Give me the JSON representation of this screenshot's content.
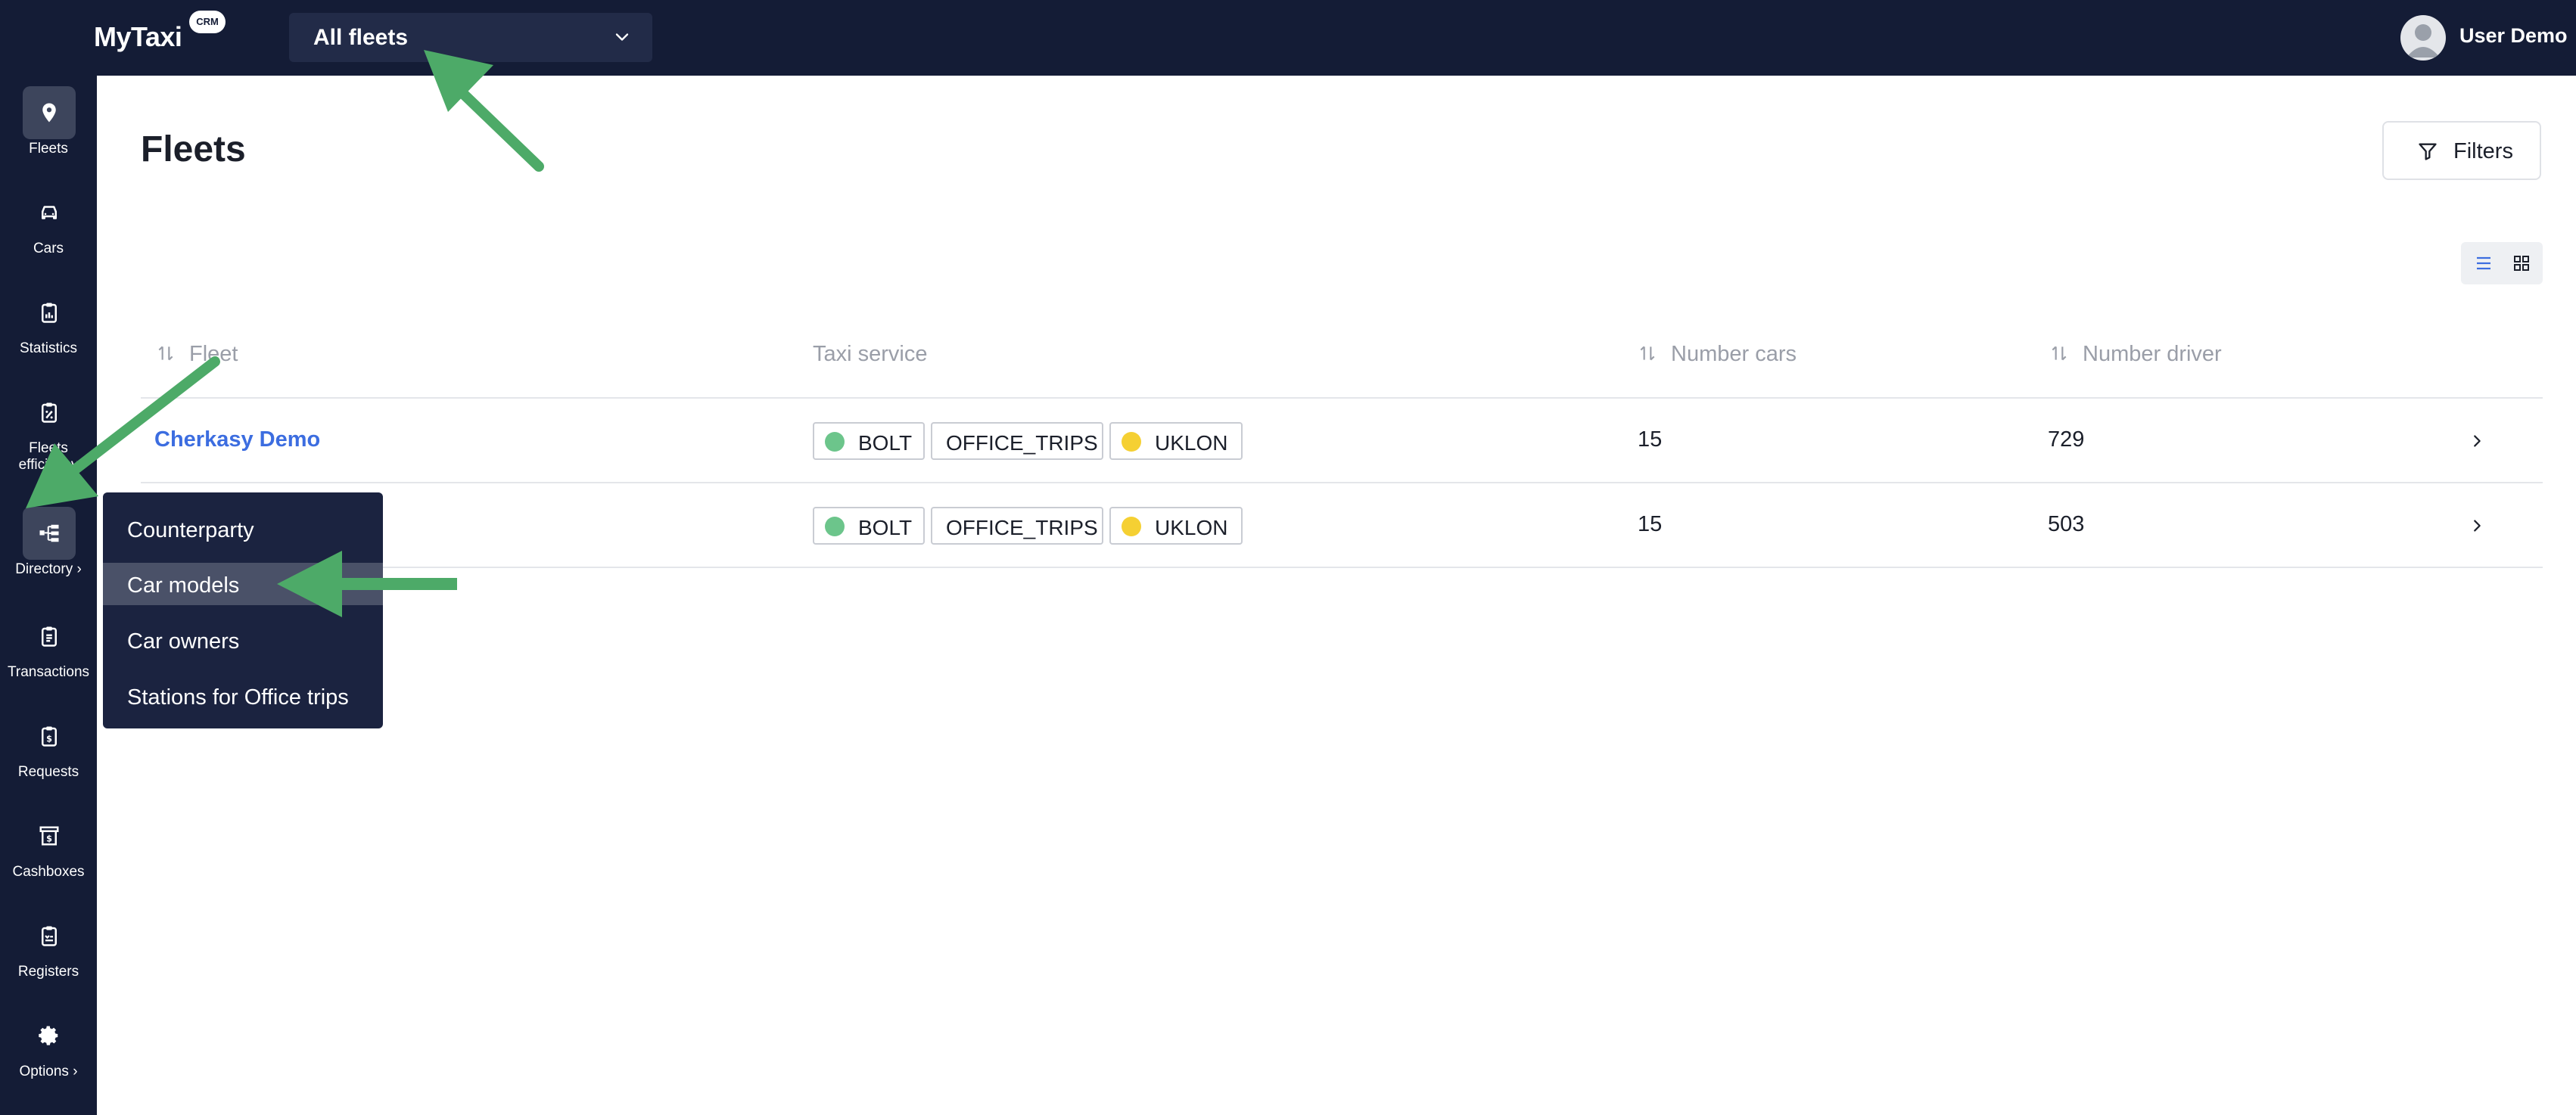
{
  "app": {
    "name": "MyTaxi",
    "badge": "CRM"
  },
  "header": {
    "fleet_selector": "All fleets",
    "user_name": "User Demo"
  },
  "sidebar": {
    "items": [
      {
        "label": "Fleets",
        "icon": "map-pin-icon",
        "active": true
      },
      {
        "label": "Cars",
        "icon": "car-icon"
      },
      {
        "label": "Statistics",
        "icon": "clipboard-chart-icon"
      },
      {
        "label": "Fleets efficiency",
        "icon": "clipboard-percent-icon"
      },
      {
        "label": "Directory ›",
        "icon": "hierarchy-icon",
        "active": true
      },
      {
        "label": "Transactions",
        "icon": "clipboard-list-icon"
      },
      {
        "label": "Requests",
        "icon": "clipboard-dollar-icon"
      },
      {
        "label": "Cashboxes",
        "icon": "cash-register-icon"
      },
      {
        "label": "Registers",
        "icon": "clipboard-check-icon"
      },
      {
        "label": "Options ›",
        "icon": "gear-icon"
      }
    ]
  },
  "main": {
    "title": "Fleets",
    "filters_label": "Filters",
    "table": {
      "columns": [
        "Fleet",
        "Taxi service",
        "Number cars",
        "Number driver"
      ],
      "rows": [
        {
          "fleet": "Cherkasy Demo",
          "services": [
            "BOLT",
            "OFFICE_TRIPS",
            "UKLON"
          ],
          "cars": "15",
          "drivers": "729"
        },
        {
          "fleet": "",
          "services": [
            "BOLT",
            "OFFICE_TRIPS",
            "UKLON"
          ],
          "cars": "15",
          "drivers": "503"
        }
      ]
    }
  },
  "directory_menu": {
    "items": [
      "Counterparty",
      "Car models",
      "Car owners",
      "Stations for Office trips"
    ],
    "hovered": "Car models"
  },
  "colors": {
    "dark_navy": "#141c36",
    "link_blue": "#3c6de0",
    "annotation_green": "#4daa68",
    "bolt_green": "#6cc58b",
    "uklon_yellow": "#f5d033"
  }
}
